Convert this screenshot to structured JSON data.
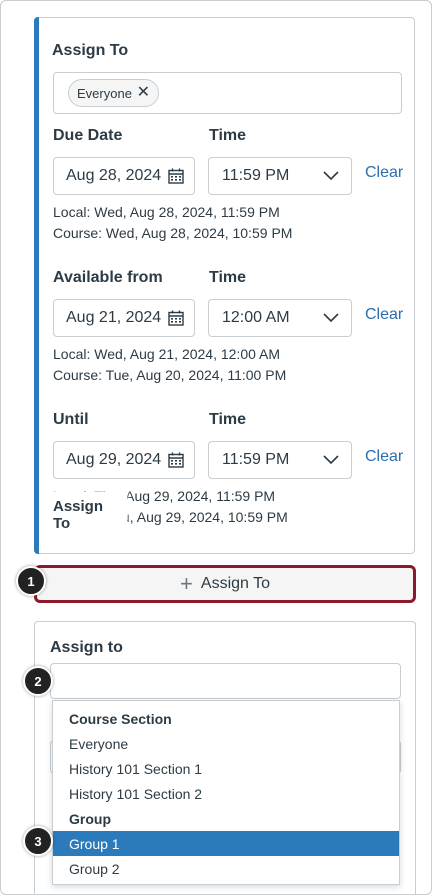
{
  "assign_card": {
    "assign_to_label": "Assign To",
    "chip_label": "Everyone",
    "rows": [
      {
        "date_label": "Due Date",
        "time_label": "Time",
        "date_value": "Aug 28, 2024",
        "time_value": "11:59 PM",
        "clear_label": "Clear",
        "local": "Local: Wed, Aug 28, 2024, 11:59 PM",
        "course": "Course: Wed, Aug 28, 2024, 10:59 PM"
      },
      {
        "date_label": "Available from",
        "time_label": "Time",
        "date_value": "Aug 21, 2024",
        "time_value": "12:00 AM",
        "clear_label": "Clear",
        "local": "Local: Wed, Aug 21, 2024, 12:00 AM",
        "course": "Course: Tue, Aug 20, 2024, 11:00 PM"
      },
      {
        "date_label": "Until",
        "time_label": "Time",
        "date_value": "Aug 29, 2024",
        "time_value": "11:59 PM",
        "clear_label": "Clear",
        "local": "Local: Thu, Aug 29, 2024, 11:59 PM",
        "course": "Course: Thu, Aug 29, 2024, 10:59 PM"
      }
    ],
    "tooltip": "Assign To"
  },
  "add_button": {
    "label": "Assign To"
  },
  "assign_card2": {
    "label": "Assign to",
    "search_value": "",
    "dropdown": {
      "groups": [
        {
          "name": "Course Section",
          "items": [
            "Everyone",
            "History 101 Section 1",
            "History 101 Section 2"
          ]
        },
        {
          "name": "Group",
          "items": [
            "Group 1",
            "Group 2"
          ]
        }
      ],
      "selected": "Group 1"
    }
  },
  "badges": [
    "1",
    "2",
    "3"
  ],
  "colors": {
    "accent": "#2b7abc",
    "focus_border": "#8b1a2b",
    "link": "#2b6fb0"
  }
}
